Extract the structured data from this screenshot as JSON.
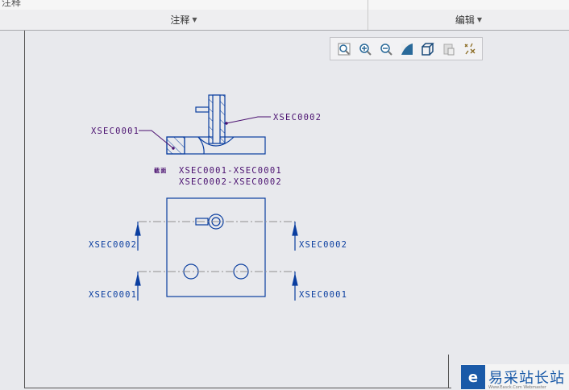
{
  "ribbon": {
    "groups": [
      {
        "label": "注释"
      },
      {
        "label": "编辑"
      }
    ],
    "top_cut_label": "注释"
  },
  "toolbar": {
    "icons": [
      "zoom-fit-icon",
      "zoom-in-icon",
      "zoom-out-icon",
      "repaint-icon",
      "view-cube-icon",
      "saved-views-icon",
      "datum-display-icon"
    ]
  },
  "drawing": {
    "section_leader_labels": [
      "XSEC0001",
      "XSEC0002"
    ],
    "section_title": "截面",
    "section_lines": [
      "XSEC0001-XSEC0001",
      "XSEC0002-XSEC0002"
    ],
    "cutting_plane_labels": {
      "left_top": "XSEC0002",
      "left_bottom": "XSEC0001",
      "right_top": "XSEC0002",
      "right_bottom": "XSEC0001"
    }
  },
  "colors": {
    "geometry": "#0a3ea0",
    "annotation": "#4a1070",
    "centerline": "#909090"
  },
  "watermark": {
    "text": "易采站长站",
    "sub": "Www.Easck.Com Webmaster"
  }
}
